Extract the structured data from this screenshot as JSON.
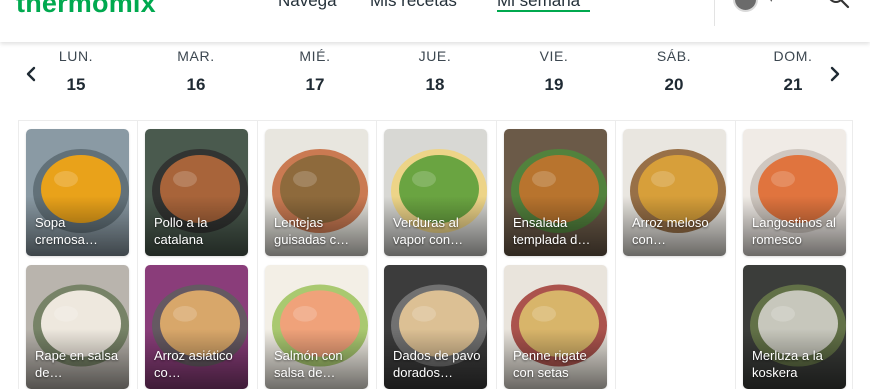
{
  "header": {
    "logo": "thermomix",
    "nav": [
      "Navega",
      "Mis recetas",
      "Mi semana"
    ]
  },
  "week": {
    "days": [
      {
        "name": "LUN.",
        "num": "15"
      },
      {
        "name": "MAR.",
        "num": "16"
      },
      {
        "name": "MIÉ.",
        "num": "17"
      },
      {
        "name": "JUE.",
        "num": "18"
      },
      {
        "name": "VIE.",
        "num": "19"
      },
      {
        "name": "SÁB.",
        "num": "20"
      },
      {
        "name": "DOM.",
        "num": "21"
      }
    ]
  },
  "recipes": {
    "row1": [
      {
        "title": "Sopa cremosa…",
        "colors": [
          "#8a9aa4",
          "#e9a21a",
          "#5b6a72"
        ]
      },
      {
        "title": "Pollo a la catalana",
        "colors": [
          "#4a5a4e",
          "#a8643a",
          "#2e2e2e"
        ]
      },
      {
        "title": "Lentejas guisadas c…",
        "colors": [
          "#e8e6df",
          "#8e6a3c",
          "#c4663a"
        ]
      },
      {
        "title": "Verduras al vapor con…",
        "colors": [
          "#d8d8d4",
          "#6aa441",
          "#f1d37a"
        ]
      },
      {
        "title": "Ensalada templada d…",
        "colors": [
          "#6b5a48",
          "#b8742e",
          "#4e8a3c"
        ]
      },
      {
        "title": "Arroz meloso con…",
        "colors": [
          "#e9e6e0",
          "#d79f3a",
          "#8a5a2c"
        ]
      },
      {
        "title": "Langostinos al romesco",
        "colors": [
          "#f0ebe6",
          "#e0743e",
          "#c9c1b8"
        ]
      }
    ],
    "row2": [
      {
        "title": "Rape en salsa de…",
        "colors": [
          "#b9b4ad",
          "#eee8de",
          "#6b7a5a"
        ]
      },
      {
        "title": "Arroz asiático co…",
        "colors": [
          "#8a3d7a",
          "#d8a76a",
          "#5e5e5e"
        ]
      },
      {
        "title": "Salmón con salsa de…",
        "colors": [
          "#f3efe6",
          "#f0a27a",
          "#9bc25a"
        ]
      },
      {
        "title": "Dados de pavo dorados…",
        "colors": [
          "#3c3c3c",
          "#dcc094",
          "#7a7a7a"
        ]
      },
      {
        "title": "Penne rigate con setas",
        "colors": [
          "#e9e4dc",
          "#d8b56a",
          "#a03a34"
        ]
      },
      null,
      {
        "title": "Merluza a la koskera",
        "colors": [
          "#3b3d3a",
          "#c7c7bc",
          "#6a7a4a"
        ]
      }
    ]
  }
}
